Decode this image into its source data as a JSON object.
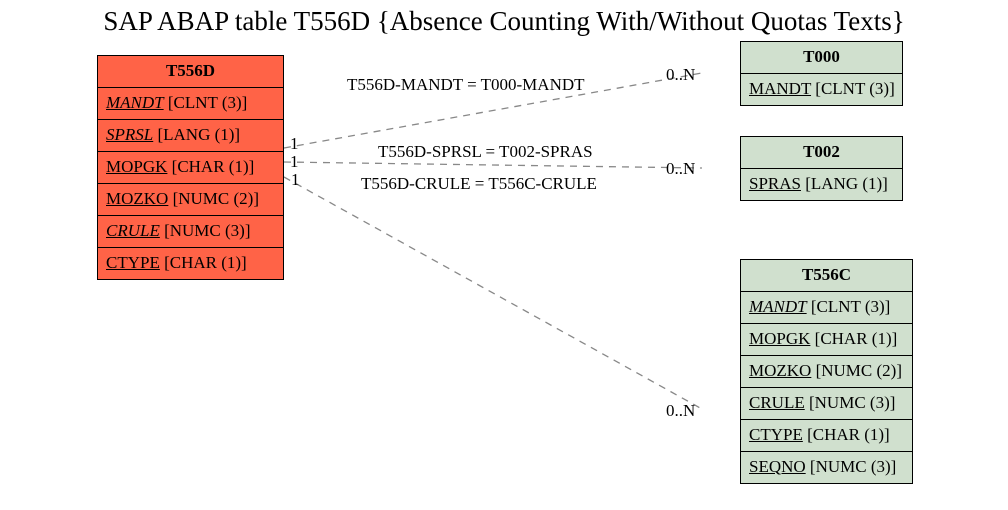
{
  "title": "SAP ABAP table T556D {Absence Counting With/Without Quotas Texts}",
  "entities": {
    "t556d": {
      "name": "T556D",
      "fields": [
        {
          "field": "MANDT",
          "type": "[CLNT (3)]",
          "ul": true,
          "it": true
        },
        {
          "field": "SPRSL",
          "type": "[LANG (1)]",
          "ul": true,
          "it": true
        },
        {
          "field": "MOPGK",
          "type": "[CHAR (1)]",
          "ul": true,
          "it": false
        },
        {
          "field": "MOZKO",
          "type": "[NUMC (2)]",
          "ul": true,
          "it": false
        },
        {
          "field": "CRULE",
          "type": "[NUMC (3)]",
          "ul": true,
          "it": true
        },
        {
          "field": "CTYPE",
          "type": "[CHAR (1)]",
          "ul": true,
          "it": false
        }
      ]
    },
    "t000": {
      "name": "T000",
      "fields": [
        {
          "field": "MANDT",
          "type": "[CLNT (3)]",
          "ul": true,
          "it": false
        }
      ]
    },
    "t002": {
      "name": "T002",
      "fields": [
        {
          "field": "SPRAS",
          "type": "[LANG (1)]",
          "ul": true,
          "it": false
        }
      ]
    },
    "t556c": {
      "name": "T556C",
      "fields": [
        {
          "field": "MANDT",
          "type": "[CLNT (3)]",
          "ul": true,
          "it": true
        },
        {
          "field": "MOPGK",
          "type": "[CHAR (1)]",
          "ul": true,
          "it": false
        },
        {
          "field": "MOZKO",
          "type": "[NUMC (2)]",
          "ul": true,
          "it": false
        },
        {
          "field": "CRULE",
          "type": "[NUMC (3)]",
          "ul": true,
          "it": false
        },
        {
          "field": "CTYPE",
          "type": "[CHAR (1)]",
          "ul": true,
          "it": false
        },
        {
          "field": "SEQNO",
          "type": "[NUMC (3)]",
          "ul": true,
          "it": false
        }
      ]
    }
  },
  "relations": [
    {
      "label": "T556D-MANDT = T000-MANDT",
      "left": "1",
      "right": "0..N"
    },
    {
      "label": "T556D-SPRSL = T002-SPRAS",
      "left": "1",
      "right": "0..N"
    },
    {
      "label": "T556D-CRULE = T556C-CRULE",
      "left": "1",
      "right": "0..N"
    }
  ]
}
